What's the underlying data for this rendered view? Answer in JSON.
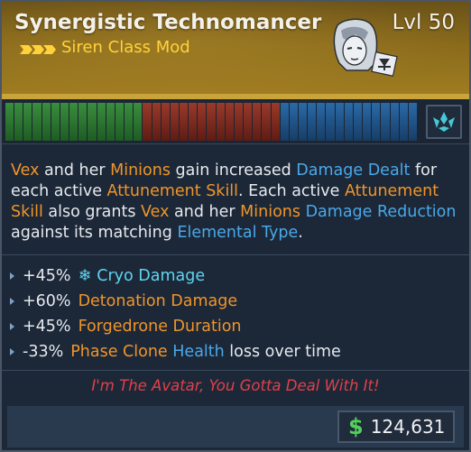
{
  "header": {
    "title": "Synergistic Technomancer",
    "level": "Lvl 50",
    "subtitle": "Siren Class Mod",
    "rarity_color": "#ffd23a",
    "portrait_icon": "siren-portrait-icon",
    "character_badge_icon": "minion-badge-icon"
  },
  "attunement": {
    "bar_colors": {
      "green": "#3a8e3e",
      "red": "#9a3a2a",
      "blue": "#2a6aa8"
    },
    "button_icon": "attunement-icon"
  },
  "description": {
    "w1": "Vex",
    "w2": " and her ",
    "w3": "Minions",
    "w4": " gain increased ",
    "w5": "Damage Dealt",
    "w6": " for each active ",
    "w7": "Attunement Skill",
    "w8": ". Each active ",
    "w9": "Attunement Skill",
    "w10": " also grants ",
    "w11": "Vex",
    "w12": " and her ",
    "w13": "Minions",
    "w14": " ",
    "w15": "Damage Reduction",
    "w16": " against its matching ",
    "w17": "Elemental Type",
    "w18": "."
  },
  "stats": [
    {
      "value": "+45%",
      "icon": "snowflake-icon",
      "label": "Cryo Damage",
      "suffix": ""
    },
    {
      "value": "+60%",
      "label": "Detonation Damage",
      "suffix": ""
    },
    {
      "value": "+45%",
      "label": "Forgedrone Duration",
      "suffix": ""
    },
    {
      "value": "-33%",
      "label": "Phase Clone",
      "label2": "Health",
      "suffix": " loss over time"
    }
  ],
  "flavor_text": "I'm The Avatar, You Gotta Deal With It!",
  "footer": {
    "currency_symbol": "$",
    "price": "124,631"
  }
}
